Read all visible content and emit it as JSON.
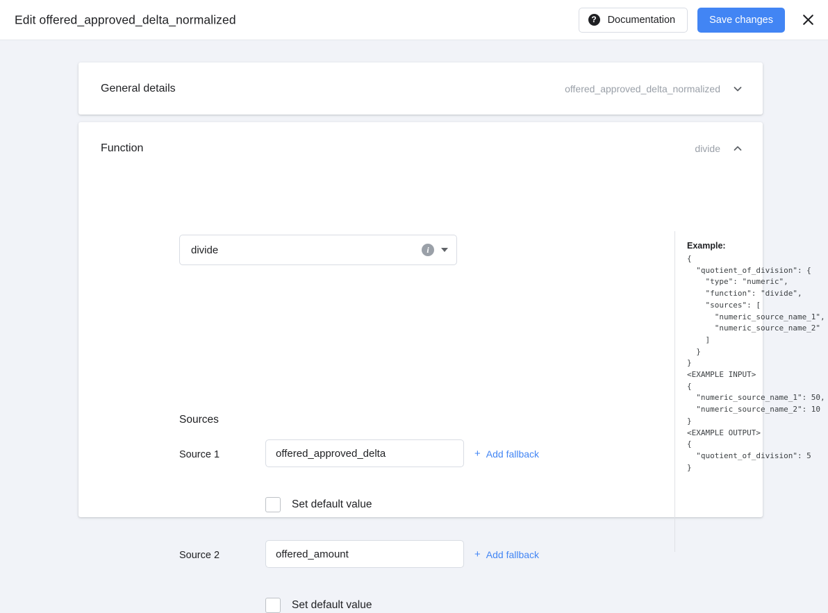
{
  "header": {
    "title": "Edit offered_approved_delta_normalized",
    "documentation_label": "Documentation",
    "documentation_icon": "help-circle-icon",
    "save_label": "Save changes",
    "close_icon": "close-icon",
    "accent_color": "#4285f4"
  },
  "general_details": {
    "title": "General details",
    "value": "offered_approved_delta_normalized",
    "chevron_icon": "chevron-down-icon",
    "expanded": false
  },
  "function_section": {
    "title": "Function",
    "value": "divide",
    "chevron_icon": "chevron-up-icon",
    "expanded": true,
    "function_select": {
      "value": "divide",
      "info_icon": "info-circle-icon",
      "caret_icon": "chevron-down-icon"
    },
    "sources_label": "Sources",
    "sources": [
      {
        "label": "Source 1",
        "value": "offered_approved_delta",
        "placeholder": "",
        "add_fallback_label": "Add fallback",
        "add_fallback_plus": "+",
        "default_checkbox_label": "Set default value",
        "default_checked": false
      },
      {
        "label": "Source 2",
        "value": "offered_amount",
        "placeholder": "",
        "add_fallback_label": "Add fallback",
        "add_fallback_plus": "+",
        "default_checkbox_label": "Set default value",
        "default_checked": false
      }
    ]
  },
  "example": {
    "title": "Example:",
    "code": "{\n  \"quotient_of_division\": {\n    \"type\": \"numeric\",\n    \"function\": \"divide\",\n    \"sources\": [\n      \"numeric_source_name_1\",\n      \"numeric_source_name_2\"\n    ]\n  }\n}\n<EXAMPLE INPUT>\n{\n  \"numeric_source_name_1\": 50,\n  \"numeric_source_name_2\": 10\n}\n<EXAMPLE OUTPUT>\n{\n  \"quotient_of_division\": 5\n}"
  }
}
